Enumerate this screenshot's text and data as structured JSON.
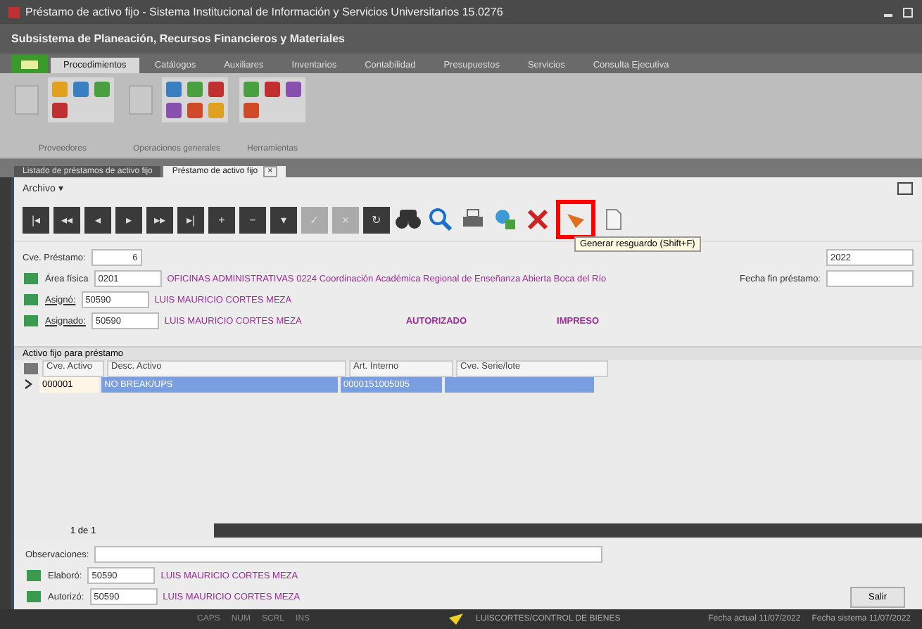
{
  "window": {
    "title": "Préstamo de activo fijo - Sistema Institucional de Información y Servicios Universitarios 15.0276"
  },
  "subsystem": {
    "title": "Subsistema de Planeación, Recursos Financieros y Materiales"
  },
  "ribbon_tabs": [
    {
      "label": "Procedimientos",
      "selected": true
    },
    {
      "label": "Catálogos",
      "selected": false
    },
    {
      "label": "Auxiliares",
      "selected": false
    },
    {
      "label": "Inventarios",
      "selected": false
    },
    {
      "label": "Contabilidad",
      "selected": false
    },
    {
      "label": "Presupuestos",
      "selected": false
    },
    {
      "label": "Servicios",
      "selected": false
    },
    {
      "label": "Consulta Ejecutiva",
      "selected": false
    }
  ],
  "ribbon_groups": [
    {
      "label": "Proveedores"
    },
    {
      "label": "Operaciones generales"
    },
    {
      "label": "Herramientas"
    }
  ],
  "doc_tabs": [
    {
      "label": "Listado de préstamos de activo fijo",
      "selected": false
    },
    {
      "label": "Préstamo de activo fijo",
      "selected": true,
      "close": "×"
    }
  ],
  "menu": {
    "label": "Archivo ▾"
  },
  "toolbar": [
    {
      "kind": "nav",
      "label": "|◂"
    },
    {
      "kind": "nav",
      "label": "◂◂"
    },
    {
      "kind": "nav",
      "label": "◂"
    },
    {
      "kind": "nav",
      "label": "▸"
    },
    {
      "kind": "nav",
      "label": "▸▸"
    },
    {
      "kind": "nav",
      "label": "▸|"
    },
    {
      "kind": "nav",
      "label": "+"
    },
    {
      "kind": "nav",
      "label": "−"
    },
    {
      "kind": "nav",
      "label": "▾"
    },
    {
      "kind": "nav",
      "label": "✓",
      "disabled": true
    },
    {
      "kind": "nav",
      "label": "×",
      "disabled": true
    },
    {
      "kind": "nav",
      "label": "↻"
    },
    {
      "kind": "binoculars"
    },
    {
      "kind": "search"
    },
    {
      "kind": "print"
    },
    {
      "kind": "network"
    },
    {
      "kind": "delete"
    },
    {
      "kind": "receipt",
      "highlighted": true
    },
    {
      "kind": "document"
    }
  ],
  "tooltip": "Generar resguardo (Shift+F)",
  "form": {
    "loan_number": {
      "label": "Cve. Préstamo:",
      "value": "6"
    },
    "area": {
      "label": "Área física",
      "value": "0201",
      "description": "OFICINAS ADMINISTRATIVAS 0224 Coordinación Académica Regional de Enseñanza Abierta Boca del Río"
    },
    "assigned_by": {
      "label": "Asignó:",
      "value": "50590",
      "name": "LUIS MAURICIO CORTES MEZA"
    },
    "assigned_to": {
      "label": "Asignado:",
      "value": "50590",
      "name": "LUIS MAURICIO CORTES MEZA"
    },
    "loan_date": {
      "value": "2022"
    },
    "end_date": {
      "label": "Fecha fin préstamo:"
    },
    "status": [
      "AUTORIZADO",
      "IMPRESO"
    ]
  },
  "grid": {
    "title": "Activo fijo para préstamo",
    "columns": [
      "Cve. Activo",
      "Desc. Activo",
      "Art. Interno",
      "Cve. Serie/lote"
    ],
    "rows": [
      {
        "cells": [
          "000001",
          "NO BREAK/UPS",
          "0000151005005",
          ""
        ],
        "selected": true
      }
    ],
    "pager": "1 de 1"
  },
  "observations": {
    "label": "Observaciones:"
  },
  "prepared_by": {
    "label": "Elaboró:",
    "value": "50590",
    "name": "LUIS MAURICIO CORTES MEZA"
  },
  "authorized_by": {
    "label": "Autorizó:",
    "value": "50590",
    "name": "LUIS MAURICIO CORTES MEZA"
  },
  "exit_button": "Salir",
  "status_bar": {
    "keys": [
      "CAPS",
      "NUM",
      "SCRL",
      "INS"
    ],
    "user": "LUISCORTES/CONTROL DE BIENES",
    "current_date": "Fecha actual 11/07/2022",
    "system_date": "Fecha sistema 11/07/2022"
  }
}
